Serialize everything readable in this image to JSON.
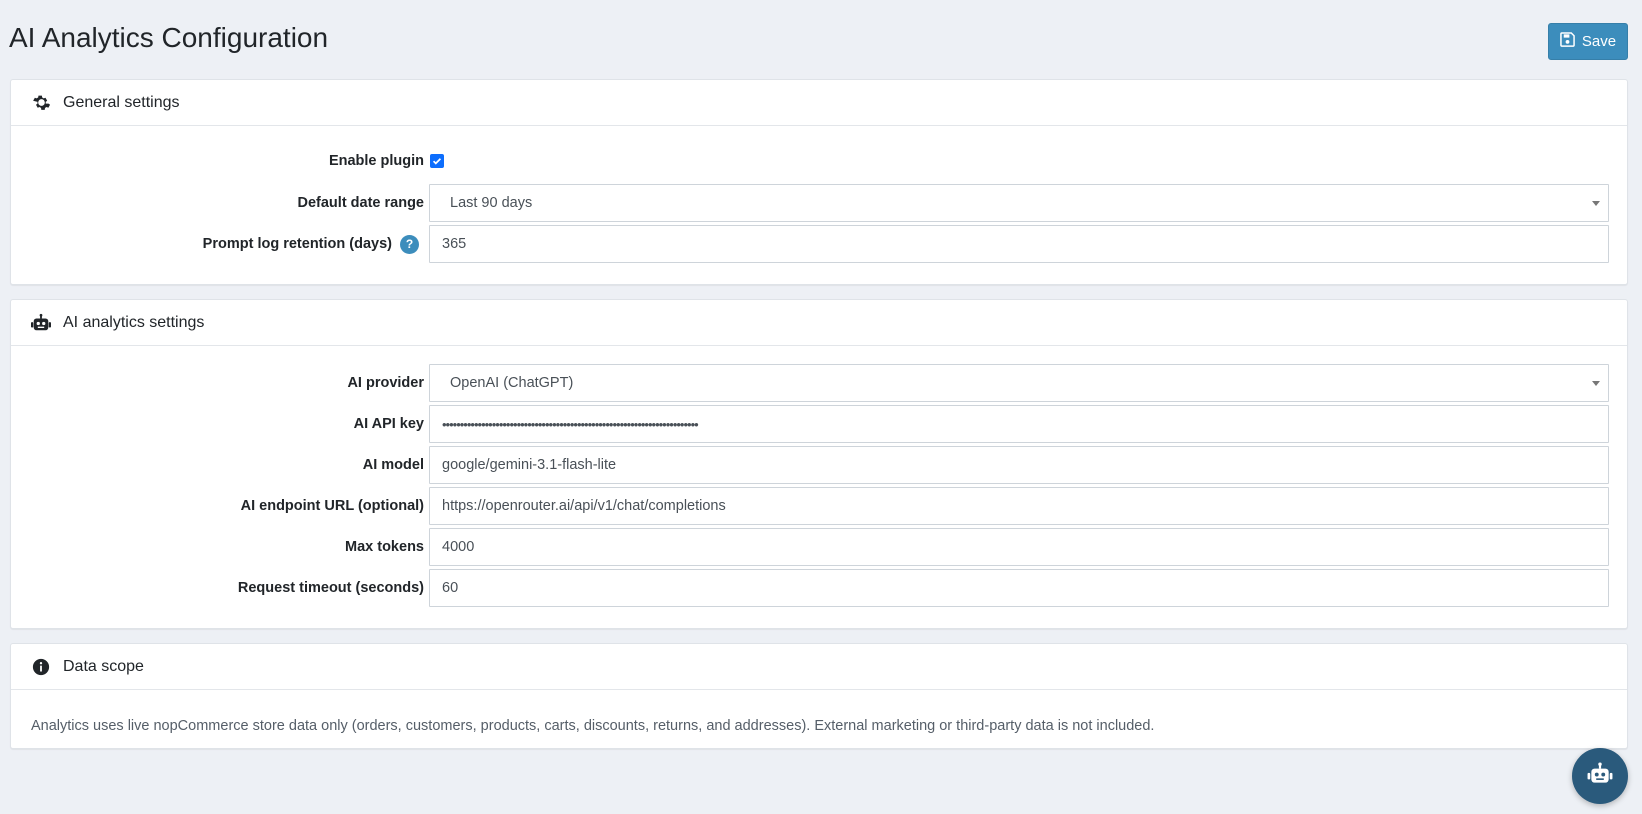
{
  "header": {
    "title": "AI Analytics Configuration",
    "save_label": "Save"
  },
  "general": {
    "title": "General settings",
    "icon": "gear-icon",
    "enable_plugin_label": "Enable plugin",
    "enable_plugin_checked": true,
    "date_range_label": "Default date range",
    "date_range_value": "Last 90 days",
    "retention_label": "Prompt log retention (days)",
    "retention_help": "?",
    "retention_value": "365"
  },
  "ai": {
    "title": "AI analytics settings",
    "icon": "robot-icon",
    "provider_label": "AI provider",
    "provider_value": "OpenAI (ChatGPT)",
    "api_key_label": "AI API key",
    "api_key_value": "••••••••••••••••••••••••••••••••••••••••••••••••••••••••••••••••••••••••",
    "model_label": "AI model",
    "model_value": "google/gemini-3.1-flash-lite",
    "endpoint_label": "AI endpoint URL (optional)",
    "endpoint_value": "https://openrouter.ai/api/v1/chat/completions",
    "max_tokens_label": "Max tokens",
    "max_tokens_value": "4000",
    "timeout_label": "Request timeout (seconds)",
    "timeout_value": "60"
  },
  "scope": {
    "title": "Data scope",
    "icon": "info-icon",
    "text": "Analytics uses live nopCommerce store data only (orders, customers, products, carts, discounts, returns, and addresses). External marketing or third-party data is not included."
  },
  "colors": {
    "primary": "#3c8dbc",
    "checkbox": "#0d6efd",
    "background": "#edf0f5",
    "chat_button": "#2a5a7c"
  }
}
